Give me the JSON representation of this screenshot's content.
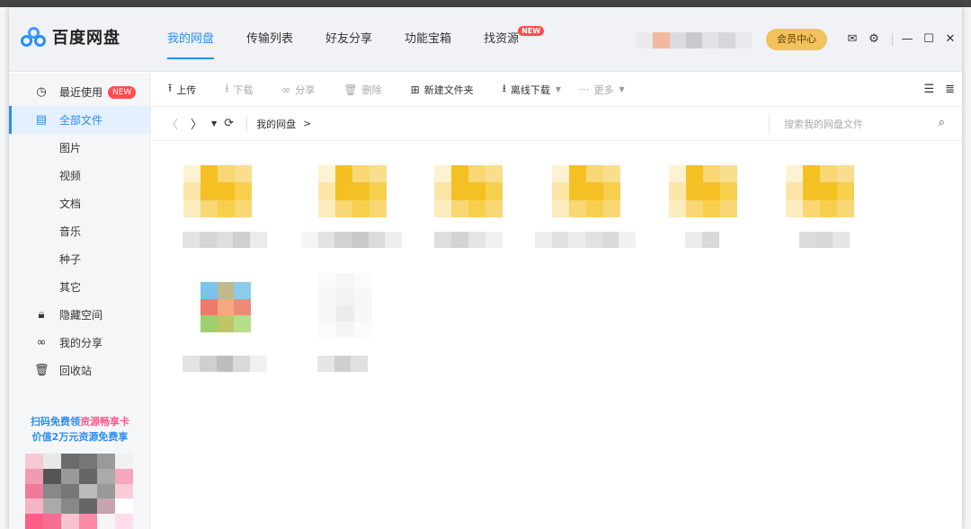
{
  "app": {
    "logo_text": "百度网盘",
    "brand_color": "#2b8df5"
  },
  "nav": {
    "tabs": [
      {
        "label": "我的网盘",
        "active": true
      },
      {
        "label": "传输列表"
      },
      {
        "label": "好友分享"
      },
      {
        "label": "功能宝箱"
      },
      {
        "label": "找资源",
        "badge": "NEW"
      }
    ]
  },
  "header": {
    "vip_label": "会员中心",
    "icons": [
      "mail-icon",
      "settings-icon",
      "minimize-icon",
      "maximize-icon",
      "close-icon"
    ]
  },
  "sidebar": {
    "items": [
      {
        "label": "最近使用",
        "icon": "clock-icon",
        "badge": "NEW"
      },
      {
        "label": "全部文件",
        "icon": "file-icon",
        "active": true
      },
      {
        "label": "图片"
      },
      {
        "label": "视频"
      },
      {
        "label": "文档"
      },
      {
        "label": "音乐"
      },
      {
        "label": "种子"
      },
      {
        "label": "其它"
      },
      {
        "label": "隐藏空间",
        "icon": "lock-icon"
      },
      {
        "label": "我的分享",
        "icon": "share-icon"
      },
      {
        "label": "回收站",
        "icon": "trash-icon"
      }
    ],
    "promo_line1a": "扫码免费领",
    "promo_line1b": "资源畅享卡",
    "promo_line2": "价值2万元资源免费享"
  },
  "toolbar": {
    "upload": "上传",
    "download": "下载",
    "share": "分享",
    "delete": "删除",
    "new_folder": "新建文件夹",
    "offline_download": "离线下载",
    "more": "更多"
  },
  "pathbar": {
    "crumb": "我的网盘",
    "crumb_sep": ">",
    "search_placeholder": "搜索我的网盘文件"
  },
  "colors": {
    "folder_dark": "#f5c024",
    "folder_light": "#f8d774",
    "accent": "#2b8df5",
    "vip": "#f2c25c"
  }
}
